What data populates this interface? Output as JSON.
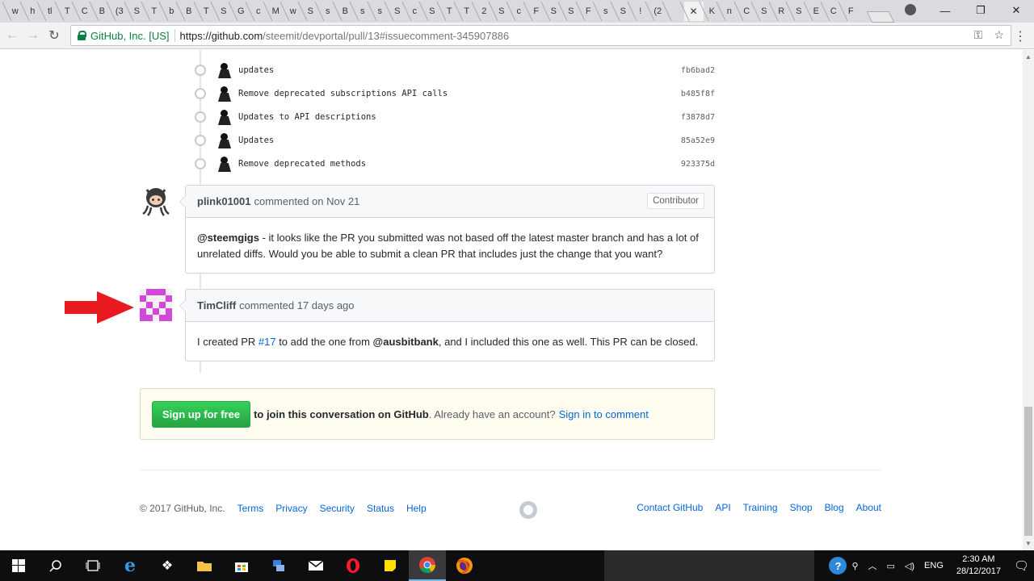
{
  "browser": {
    "tabs": [
      "w",
      "h",
      "tl",
      "T",
      "C",
      "B",
      "(3",
      "S",
      "T",
      "b",
      "B",
      "T",
      "S",
      "G",
      "c",
      "M",
      "w",
      "S",
      "s",
      "B",
      "s",
      "s",
      "S",
      "c",
      "S",
      "T",
      "T",
      "2",
      "S",
      "c",
      "F",
      "S",
      "S",
      "F",
      "s",
      "S",
      "!",
      "(2",
      "",
      "K",
      "n",
      "C",
      "S",
      "R",
      "S",
      "E",
      "C",
      "F"
    ],
    "active_tab_close": "✕",
    "window_controls": [
      "—",
      "❐",
      "✕"
    ],
    "security_label": "GitHub, Inc. [US]",
    "url_host": "https://github.com",
    "url_path": "/steemit/devportal/pull/13#issuecomment-345907886"
  },
  "commits": [
    {
      "message": "updates",
      "sha": "fb6bad2"
    },
    {
      "message": "Remove deprecated subscriptions API calls",
      "sha": "b485f8f"
    },
    {
      "message": "Updates to API descriptions",
      "sha": "f3878d7"
    },
    {
      "message": "Updates",
      "sha": "85a52e9"
    },
    {
      "message": "Remove deprecated methods",
      "sha": "923375d"
    }
  ],
  "comment1": {
    "author": "plink01001",
    "meta": "commented on Nov 21",
    "badge": "Contributor",
    "mention": "@steemgigs",
    "body": " - it looks like the PR you submitted was not based off the latest master branch and has a lot of unrelated diffs. Would you be able to submit a clean PR that includes just the change that you want?"
  },
  "comment2": {
    "author": "TimCliff",
    "meta": "commented 17 days ago",
    "body_pre": "I created PR ",
    "pr_link": "#17",
    "body_mid": " to add the one from ",
    "mention": "@ausbitbank",
    "body_post": ", and I included this one as well. This PR can be closed."
  },
  "signup": {
    "button": "Sign up for free",
    "bold_text": "to join this conversation on GitHub",
    "muted_text": ". Already have an account?",
    "signin_link": "Sign in to comment"
  },
  "footer": {
    "copyright": "© 2017 GitHub, Inc.",
    "left_links": [
      "Terms",
      "Privacy",
      "Security",
      "Status",
      "Help"
    ],
    "right_links": [
      "Contact GitHub",
      "API",
      "Training",
      "Shop",
      "Blog",
      "About"
    ]
  },
  "taskbar": {
    "language": "ENG",
    "time": "2:30 AM",
    "date": "28/12/2017"
  },
  "colors": {
    "annotation_arrow": "#e8191f",
    "identicon": "#d149d6",
    "signup_green": "#28a745",
    "link_blue": "#0366d6"
  }
}
